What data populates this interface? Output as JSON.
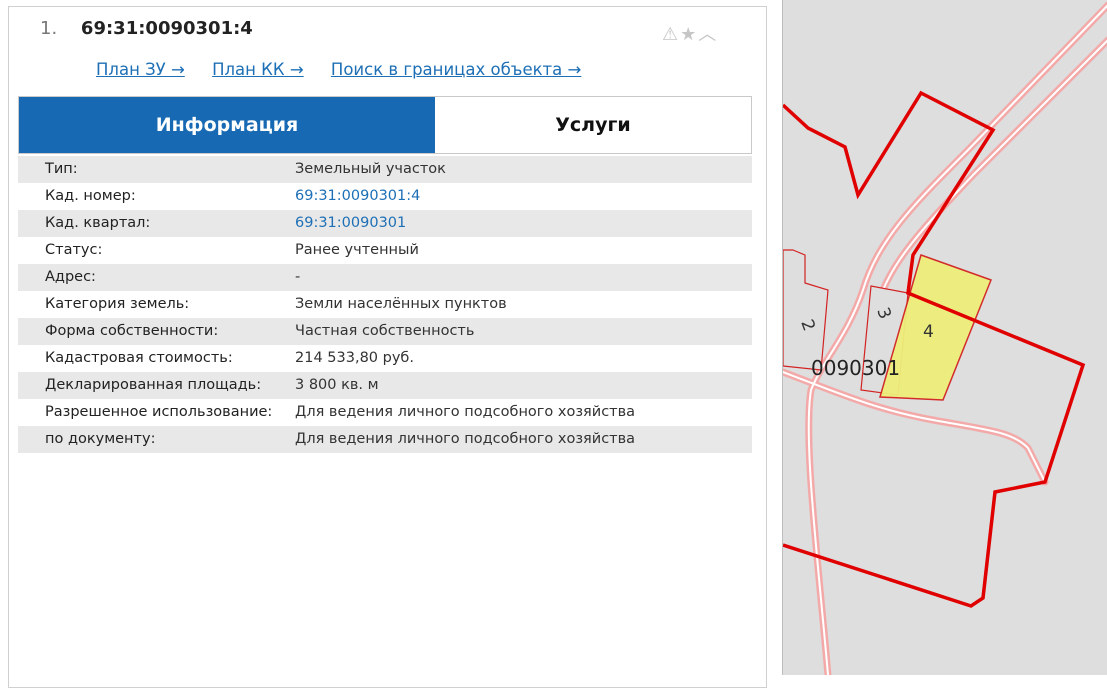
{
  "header": {
    "index": "1.",
    "cadastral_number": "69:31:0090301:4",
    "icons": [
      "warning-icon",
      "star-icon",
      "collapse-chevron-icon"
    ]
  },
  "links": {
    "plan_zu": "План ЗУ →",
    "plan_kk": "План КК →",
    "search_bounds": "Поиск в границах объекта →"
  },
  "tabs": {
    "info": "Информация",
    "services": "Услуги",
    "active": "info"
  },
  "attributes": [
    {
      "label": "Тип:",
      "value": "Земельный участок"
    },
    {
      "label": "Кад. номер:",
      "value": "69:31:0090301:4",
      "link": true
    },
    {
      "label": "Кад. квартал:",
      "value": "69:31:0090301",
      "link": true
    },
    {
      "label": "Статус:",
      "value": "Ранее учтенный"
    },
    {
      "label": "Адрес:",
      "value": "-"
    },
    {
      "label": "Категория земель:",
      "value": "Земли населённых пунктов"
    },
    {
      "label": "Форма собственности:",
      "value": "Частная собственность"
    },
    {
      "label": "Кадастровая стоимость:",
      "value": "214 533,80 руб."
    },
    {
      "label": "Декларированная площадь:",
      "value": "3 800 кв. м"
    },
    {
      "label": "Разрешенное использование:",
      "value": "Для ведения личного подсобного хозяйства"
    },
    {
      "label": "по документу:",
      "value": "Для ведения личного подсобного хозяйства"
    }
  ],
  "map": {
    "quarter_label": "0090301",
    "parcel_labels": [
      "2",
      "3",
      "4"
    ],
    "colors": {
      "background": "#dedede",
      "boundary": "#e00000",
      "road": "#f4a9a9",
      "highlight_fill": "#eeee7a"
    }
  }
}
